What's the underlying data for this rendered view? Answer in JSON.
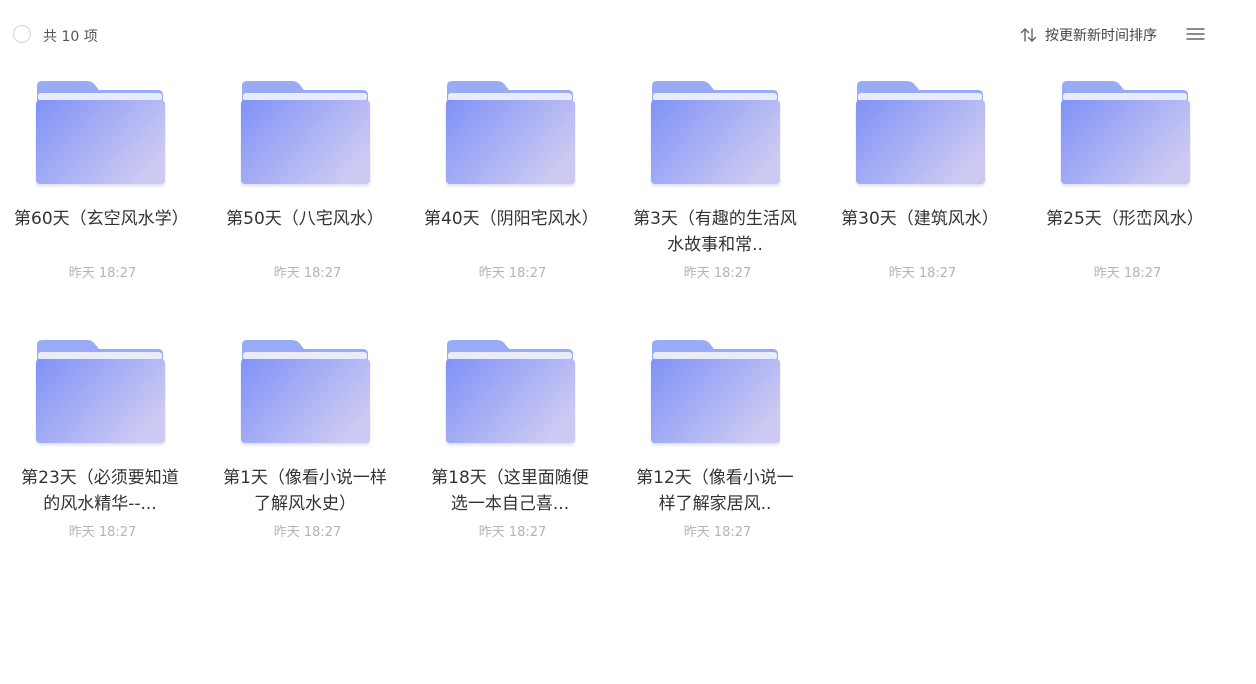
{
  "header": {
    "count_label": "共 10 项",
    "sort_label": "按更新新时间排序"
  },
  "colors": {
    "folder_back": "#9aabf5",
    "folder_front_start": "#7f92f7",
    "folder_front_end": "#ccc9f2",
    "date_text": "#b4b4b4"
  },
  "folders": [
    {
      "name": "第60天（玄空风水学）",
      "date": "昨天 18:27"
    },
    {
      "name": "第50天（八宅风水）",
      "date": "昨天 18:27"
    },
    {
      "name": "第40天（阴阳宅风水）",
      "date": "昨天 18:27"
    },
    {
      "name": "第3天（有趣的生活风水故事和常..",
      "date": "昨天 18:27"
    },
    {
      "name": "第30天（建筑风水）",
      "date": "昨天 18:27"
    },
    {
      "name": "第25天（形峦风水）",
      "date": "昨天 18:27"
    },
    {
      "name": "第23天（必须要知道的风水精华--...",
      "date": "昨天 18:27"
    },
    {
      "name": "第1天（像看小说一样了解风水史）",
      "date": "昨天 18:27"
    },
    {
      "name": "第18天（这里面随便选一本自己喜...",
      "date": "昨天 18:27"
    },
    {
      "name": "第12天（像看小说一样了解家居风..",
      "date": "昨天 18:27"
    }
  ]
}
